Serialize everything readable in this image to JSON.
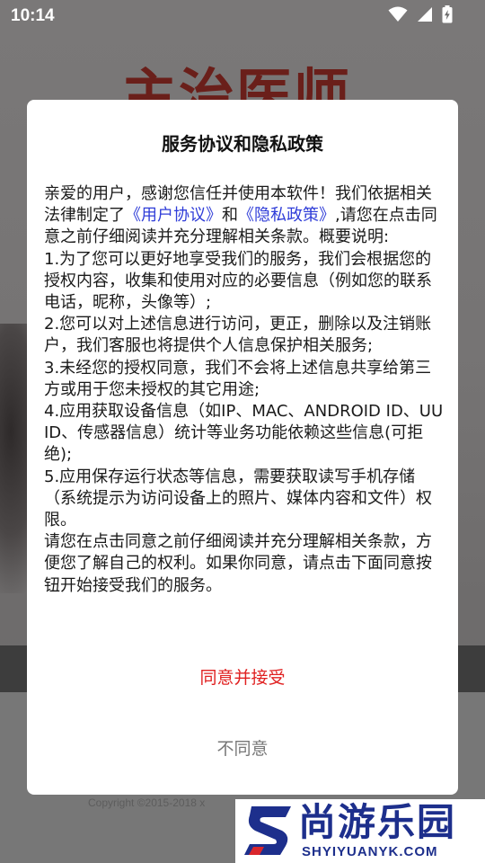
{
  "status_bar": {
    "time": "10:14",
    "icons": [
      "wifi-icon",
      "signal-icon",
      "battery-charging-icon"
    ]
  },
  "background": {
    "title": "主治医师",
    "copyright": "Copyright ©2015-2018 x"
  },
  "dialog": {
    "title": "服务协议和隐私政策",
    "intro_before": "亲爱的用户，感谢您信任并使用本软件！我们依据相关法律制定了",
    "user_agreement_link": "《用户协议》",
    "and": "和",
    "privacy_policy_link": "《隐私政策》",
    "intro_after": ",请您在点击同意之前仔细阅读并充分理解相关条款。概要说明:",
    "items": [
      "1.为了您可以更好地享受我们的服务，我们会根据您的授权内容，收集和使用对应的必要信息（例如您的联系电话，昵称，头像等）;",
      "2.您可以对上述信息进行访问，更正，删除以及注销账户，我们客服也将提供个人信息保护相关服务;",
      "3.未经您的授权同意，我们不会将上述信息共享给第三方或用于您未授权的其它用途;",
      "4.应用获取设备信息（如IP、MAC、ANDROID ID、UUID、传感器信息）统计等业务功能依赖这些信息(可拒绝);",
      "5.应用保存运行状态等信息，需要获取读写手机存储（系统提示为访问设备上的照片、媒体内容和文件）权限。"
    ],
    "closing": "请您在点击同意之前仔细阅读并充分理解相关条款，方便您了解自己的权利。如果你同意，请点击下面同意按钮开始接受我们的服务。",
    "agree_label": "同意并接受",
    "disagree_label": "不同意"
  },
  "watermark": {
    "text": "尚游乐园",
    "url": "SHYIYUANYK.COM"
  },
  "colors": {
    "link": "#2f3dd8",
    "agree": "#e02020",
    "disagree": "#777777",
    "watermark": "#1d2f8c"
  }
}
